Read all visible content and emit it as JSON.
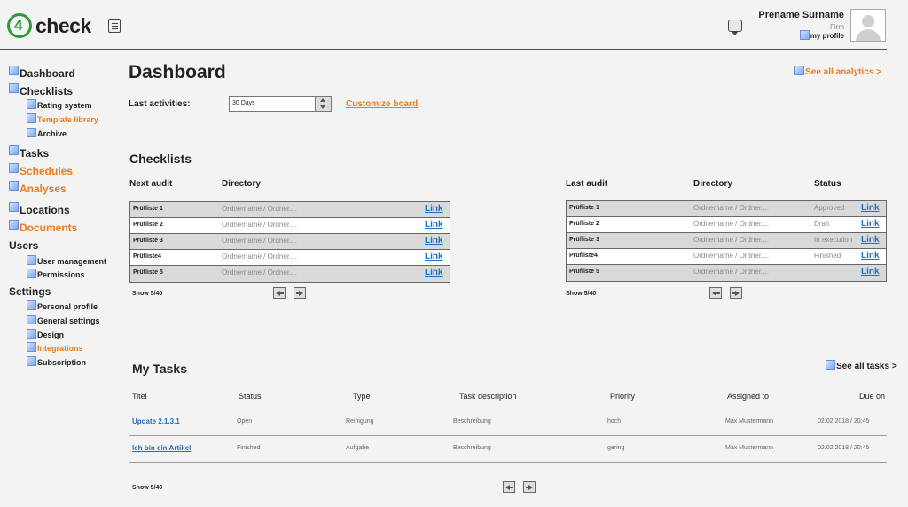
{
  "header": {
    "logo_digit": "4",
    "logo_text": "check",
    "user_name": "Prename Surname",
    "firm": "Firm",
    "profile_link": "my profile"
  },
  "sidebar": {
    "dashboard": "Dashboard",
    "checklists": "Checklists",
    "rating_system": "Rating system",
    "template_library": "Template library",
    "archive": "Archive",
    "tasks": "Tasks",
    "schedules": "Schedules",
    "analyses": "Analyses",
    "locations": "Locations",
    "documents": "Documents",
    "users": "Users",
    "user_management": "User management",
    "permissions": "Permissions",
    "settings": "Settings",
    "personal_profile": "Personal profile",
    "general_settings": "General settings",
    "design": "Design",
    "integrations": "Integrations",
    "subscription": "Subscription"
  },
  "main": {
    "title": "Dashboard",
    "see_all_analytics": "See all analytics >",
    "last_activities_label": "Last activities:",
    "last_activities_value": "30 Days",
    "customize_board": "Customize board"
  },
  "checklists": {
    "title": "Checklists",
    "left": {
      "headers": {
        "next_audit": "Next audit",
        "directory": "Directory"
      },
      "rows": [
        {
          "name": "Prüfliste 1",
          "directory": "Ordnername / Ordner....",
          "link": "Link"
        },
        {
          "name": "Prüfliste 2",
          "directory": "Ordnername / Ordner....",
          "link": "Link"
        },
        {
          "name": "Prüfliste 3",
          "directory": "Ordnername / Ordner....",
          "link": "Link"
        },
        {
          "name": "Prüfliste4",
          "directory": "Ordnername / Ordner....",
          "link": "Link"
        },
        {
          "name": "Prüfliste 5",
          "directory": "Ordnername / Ordner....",
          "link": "Link"
        }
      ],
      "show": "Show 5/40"
    },
    "right": {
      "headers": {
        "last_audit": "Last audit",
        "directory": "Directory",
        "status": "Status"
      },
      "rows": [
        {
          "name": "Prüfliste 1",
          "directory": "Ordnername / Ordner....",
          "status": "Approved",
          "link": "Link"
        },
        {
          "name": "Prüfliste 2",
          "directory": "Ordnername / Ordner....",
          "status": "Draft",
          "link": "Link"
        },
        {
          "name": "Prüfliste 3",
          "directory": "Ordnername / Ordner....",
          "status": "In execution",
          "link": "Link"
        },
        {
          "name": "Prüfliste4",
          "directory": "Ordnername / Ordner....",
          "status": "Finished",
          "link": "Link"
        },
        {
          "name": "Prüfliste 5",
          "directory": "Ordnername / Ordner....",
          "status": "",
          "link": "Link"
        }
      ],
      "show": "Show 5/40"
    }
  },
  "tasks": {
    "title": "My Tasks",
    "see_all": "See all tasks >",
    "headers": {
      "titel": "Titel",
      "status": "Status",
      "type": "Type",
      "description": "Task description",
      "priority": "Priority",
      "assigned": "Assigned to",
      "due": "Due on"
    },
    "rows": [
      {
        "title": "Update 2.1.3.1",
        "status": "Open",
        "type": "Reinigung",
        "description": "Beschreibung",
        "priority": "hoch",
        "assigned": "Max Mustermann",
        "due": "02.02.2018 / 20:45"
      },
      {
        "title": "Ich bin ein Artikel",
        "status": "Finished",
        "type": "Aufgabe",
        "description": "Beschreibung",
        "priority": "gering",
        "assigned": "Max Mustermann",
        "due": "02.02.2018 / 20:45"
      }
    ],
    "show": "Show 5/40"
  },
  "colors": {
    "accent": "#e87c1e",
    "brand_green": "#2f9a3b",
    "link_blue": "#1f6fc2"
  },
  "icons": [
    "menu-icon",
    "chat-icon",
    "avatar-placeholder-icon",
    "broken-image-icon",
    "prev-page-icon",
    "next-page-icon",
    "spinner-arrows-icon"
  ]
}
